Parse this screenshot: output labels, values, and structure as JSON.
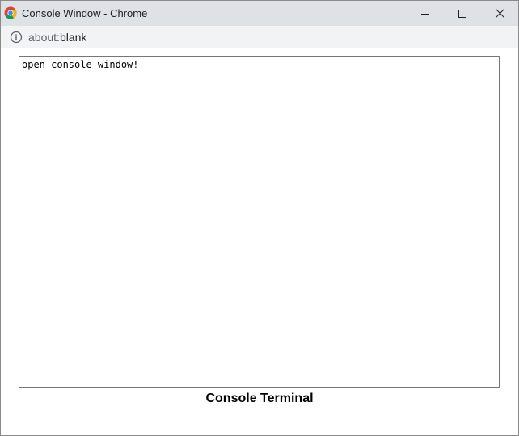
{
  "window": {
    "title": "Console Window - Chrome"
  },
  "addressbar": {
    "url_scheme": "about:",
    "url_host": "blank"
  },
  "console": {
    "text": "open console window!"
  },
  "caption": "Console Terminal",
  "icons": {
    "app": "chrome-icon",
    "info": "info-icon",
    "minimize": "minimize-icon",
    "maximize": "maximize-icon",
    "close": "close-icon"
  },
  "colors": {
    "titlebar": "#dee1e6",
    "addressbar": "#f1f3f4"
  }
}
